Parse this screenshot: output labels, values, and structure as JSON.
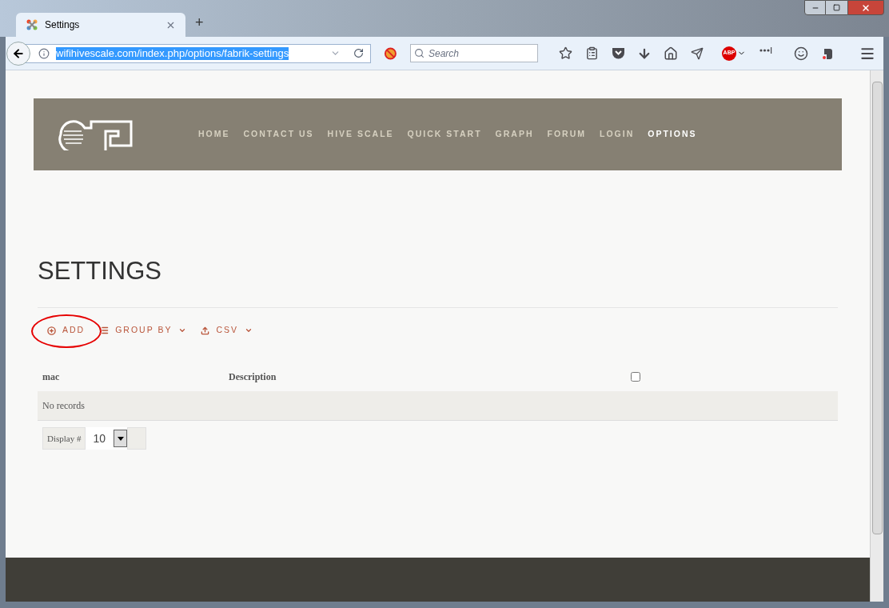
{
  "browser": {
    "tab_title": "Settings",
    "new_tab": "+",
    "url": "wifihivescale.com/index.php/options/fabrik-settings",
    "search_placeholder": "Search",
    "adblock_label": "ABP"
  },
  "nav": [
    {
      "label": "HOME",
      "selected": false
    },
    {
      "label": "CONTACT US",
      "selected": false
    },
    {
      "label": "HIVE SCALE",
      "selected": false
    },
    {
      "label": "QUICK START",
      "selected": false
    },
    {
      "label": "GRAPH",
      "selected": false
    },
    {
      "label": "FORUM",
      "selected": false
    },
    {
      "label": "LOGIN",
      "selected": false
    },
    {
      "label": "OPTIONS",
      "selected": true
    }
  ],
  "page_title": "SETTINGS",
  "actions": [
    {
      "kind": "add",
      "label": "ADD",
      "circled": true
    },
    {
      "kind": "group",
      "label": "GROUP BY",
      "circled": false
    },
    {
      "kind": "csv",
      "label": "CSV",
      "circled": false
    }
  ],
  "table": {
    "columns": [
      "mac",
      "Description"
    ],
    "select_all_checked": false,
    "empty_message": "No records"
  },
  "display": {
    "label": "Display #",
    "value": "10"
  }
}
